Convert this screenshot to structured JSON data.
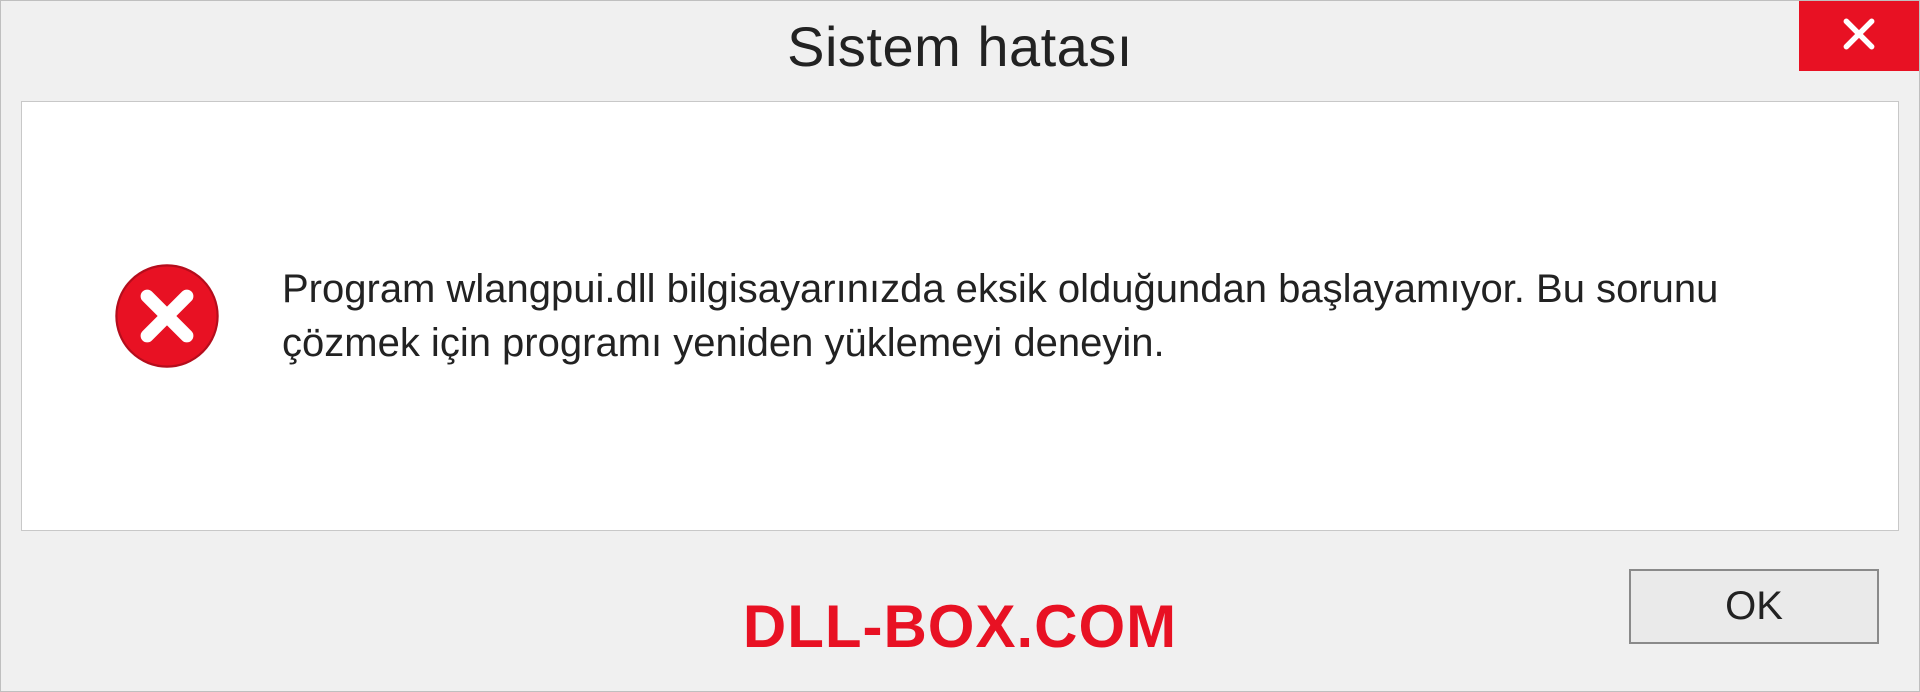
{
  "titlebar": {
    "title": "Sistem hatası"
  },
  "body": {
    "message": "Program wlangpui.dll bilgisayarınızda eksik olduğundan başlayamıyor. Bu sorunu çözmek için programı yeniden yüklemeyi deneyin."
  },
  "footer": {
    "watermark": "DLL-BOX.COM",
    "ok_label": "OK"
  },
  "colors": {
    "accent_red": "#e81123",
    "panel_bg": "#ffffff",
    "dialog_bg": "#f0f0f0",
    "border": "#c8c8c8"
  }
}
